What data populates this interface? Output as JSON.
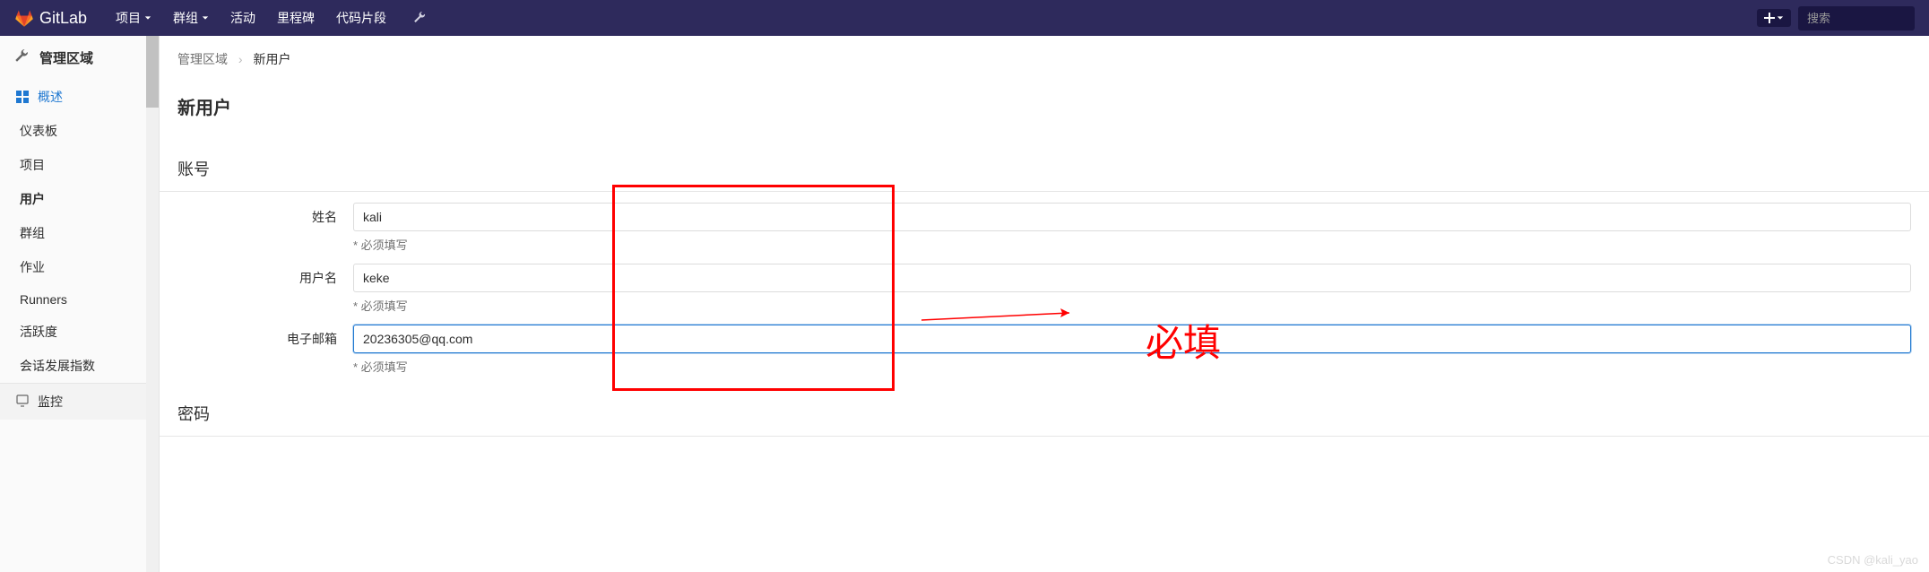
{
  "navbar": {
    "logo_text": "GitLab",
    "items": [
      {
        "label": "项目",
        "caret": true
      },
      {
        "label": "群组",
        "caret": true
      },
      {
        "label": "活动",
        "caret": false
      },
      {
        "label": "里程碑",
        "caret": false
      },
      {
        "label": "代码片段",
        "caret": false
      }
    ],
    "search_placeholder": "搜索"
  },
  "sidebar": {
    "header": "管理区域",
    "items": [
      {
        "label": "概述",
        "type": "active-parent"
      },
      {
        "label": "仪表板",
        "type": "indent"
      },
      {
        "label": "项目",
        "type": "indent"
      },
      {
        "label": "用户",
        "type": "indent active"
      },
      {
        "label": "群组",
        "type": "indent"
      },
      {
        "label": "作业",
        "type": "indent"
      },
      {
        "label": "Runners",
        "type": "indent"
      },
      {
        "label": "活跃度",
        "type": "indent"
      },
      {
        "label": "会话发展指数",
        "type": "indent"
      }
    ],
    "bottom": "监控"
  },
  "breadcrumb": {
    "root": "管理区域",
    "current": "新用户"
  },
  "page": {
    "title": "新用户",
    "section_account": "账号",
    "section_password": "密码"
  },
  "form": {
    "name_label": "姓名",
    "name_value": "kali",
    "username_label": "用户名",
    "username_value": "keke",
    "email_label": "电子邮箱",
    "email_value": "20236305@qq.com",
    "required_hint": "* 必须填写"
  },
  "annotation": {
    "text": "必填"
  },
  "watermark": "CSDN @kali_yao"
}
